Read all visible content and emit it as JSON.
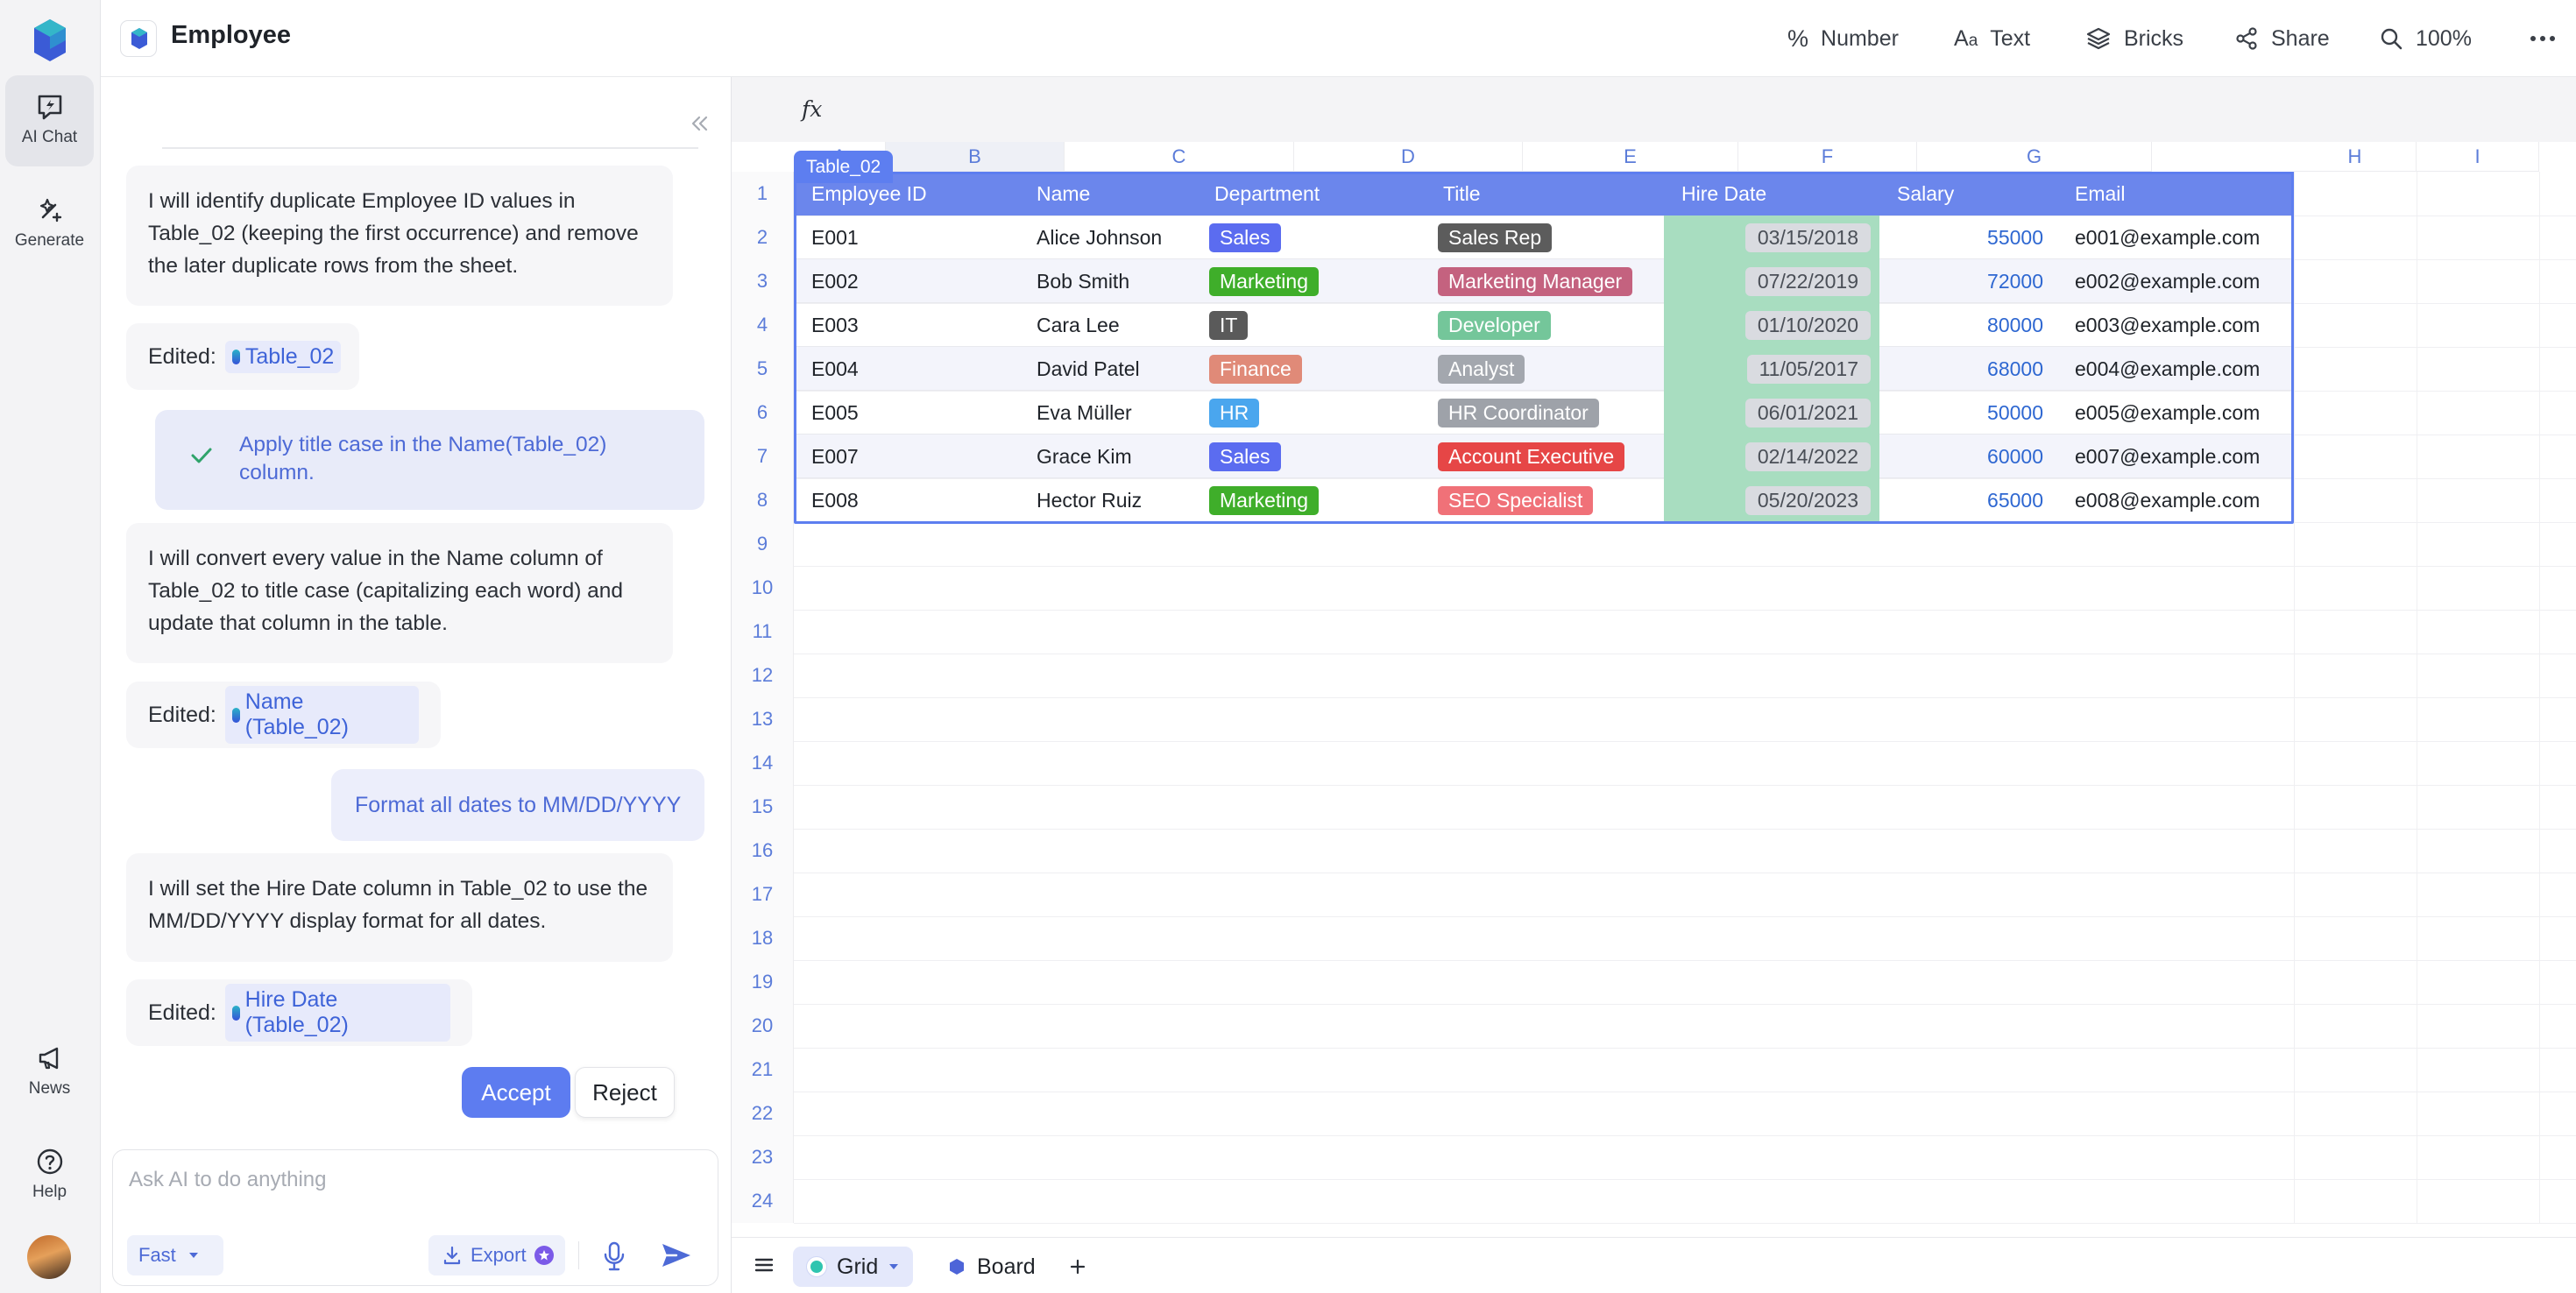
{
  "doc": {
    "title": "Employee"
  },
  "toolbar": {
    "number": "Number",
    "text": "Text",
    "bricks": "Bricks",
    "share": "Share",
    "zoom": "100%"
  },
  "rail": {
    "ai_chat": "AI Chat",
    "generate": "Generate",
    "news": "News",
    "help": "Help"
  },
  "chat": {
    "messages": {
      "ai1": "I will identify duplicate Employee ID values in Table_02 (keeping the first occurrence) and remove the later duplicate rows from the sheet.",
      "edited_label": "Edited:",
      "edit1_chip": "Table_02",
      "suggestion": "Apply title case in the Name(Table_02) column.",
      "ai2": "I will convert every value in the Name column of Table_02 to title case (capitalizing each word) and update that column in the table.",
      "edit2_chip": "Name (Table_02)",
      "user1": "Format all dates to MM/DD/YYYY",
      "ai3": "I will set the Hire Date column in Table_02 to use the MM/DD/YYYY display format for all dates.",
      "edit3_chip": "Hire Date (Table_02)"
    },
    "accept": "Accept",
    "reject": "Reject",
    "composer": {
      "placeholder": "Ask AI to do anything",
      "mode": "Fast",
      "export": "Export"
    }
  },
  "sheet": {
    "formula_label": "fx",
    "table_name": "Table_02",
    "columns": [
      "A",
      "B",
      "C",
      "D",
      "E",
      "F",
      "G",
      "H",
      "I"
    ],
    "row_numbers": [
      "1",
      "2",
      "3",
      "4",
      "5",
      "6",
      "7",
      "8",
      "9",
      "10",
      "11",
      "12",
      "13",
      "14",
      "15",
      "16",
      "17",
      "18",
      "19",
      "20",
      "21",
      "22",
      "23",
      "24"
    ],
    "headers": [
      "Employee ID",
      "Name",
      "Department",
      "Title",
      "Hire Date",
      "Salary",
      "Email"
    ],
    "rows": [
      {
        "id": "E001",
        "name": "Alice Johnson",
        "dept": "Sales",
        "title": "Sales Rep",
        "hire": "03/15/2018",
        "salary": "55000",
        "email": "e001@example.com"
      },
      {
        "id": "E002",
        "name": "Bob Smith",
        "dept": "Marketing",
        "title": "Marketing Manager",
        "hire": "07/22/2019",
        "salary": "72000",
        "email": "e002@example.com"
      },
      {
        "id": "E003",
        "name": "Cara Lee",
        "dept": "IT",
        "title": "Developer",
        "hire": "01/10/2020",
        "salary": "80000",
        "email": "e003@example.com"
      },
      {
        "id": "E004",
        "name": "David Patel",
        "dept": "Finance",
        "title": "Analyst",
        "hire": "11/05/2017",
        "salary": "68000",
        "email": "e004@example.com"
      },
      {
        "id": "E005",
        "name": "Eva Müller",
        "dept": "HR",
        "title": "HR Coordinator",
        "hire": "06/01/2021",
        "salary": "50000",
        "email": "e005@example.com"
      },
      {
        "id": "E007",
        "name": "Grace Kim",
        "dept": "Sales",
        "title": "Account Executive",
        "hire": "02/14/2022",
        "salary": "60000",
        "email": "e007@example.com"
      },
      {
        "id": "E008",
        "name": "Hector Ruiz",
        "dept": "Marketing",
        "title": "SEO Specialist",
        "hire": "05/20/2023",
        "salary": "65000",
        "email": "e008@example.com"
      }
    ],
    "dept_colors": {
      "Sales": "#5b6cf0",
      "Marketing": "#3fae2a",
      "IT": "#5a5a5a",
      "Finance": "#e08a78",
      "HR": "#4aa6ee"
    },
    "title_colors": {
      "Sales Rep": "#5c5c5c",
      "Marketing Manager": "#c4627f",
      "Developer": "#74c69a",
      "Analyst": "#a3a7ae",
      "HR Coordinator": "#9ea2a9",
      "Account Executive": "#e64646",
      "SEO Specialist": "#f07178"
    }
  },
  "bottombar": {
    "views": [
      {
        "label": "Grid"
      },
      {
        "label": "Board"
      }
    ]
  },
  "colors": {
    "accent": "#5d7ef0",
    "table_header": "#6b86ec",
    "hire_date_column": "#a8ddc0",
    "link_blue": "#3e63d8"
  }
}
